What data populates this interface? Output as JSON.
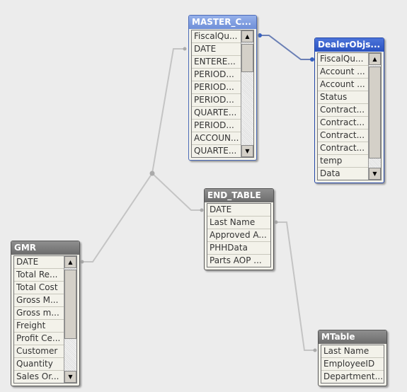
{
  "colors": {
    "link": "#c0c0c0",
    "selected_link": "#6a7fb5",
    "selected_header": "#2a52c0",
    "linked_header": "#7f9fdf",
    "table_header": "#777777"
  },
  "tables": {
    "master": {
      "title": "MASTER_C...",
      "fields": [
        "FiscalQu...",
        "DATE",
        "ENTERE...",
        "PERIOD...",
        "PERIOD...",
        "PERIOD...",
        "QUARTE...",
        "PERIOD...",
        "ACCOUN...",
        "QUARTE..."
      ]
    },
    "dealer": {
      "title": "DealerObjs...",
      "fields": [
        "FiscalQu...",
        "Account ...",
        "Account ...",
        "Status",
        "Contract...",
        "Contract...",
        "Contract...",
        "Contract...",
        "temp",
        "Data"
      ]
    },
    "end": {
      "title": "END_TABLE",
      "fields": [
        "DATE",
        "Last Name",
        "Approved A...",
        "PHHData",
        "Parts AOP ..."
      ]
    },
    "gmr": {
      "title": "GMR",
      "fields": [
        "DATE",
        "Total Re...",
        "Total Cost",
        "Gross M...",
        "Gross m...",
        "Freight",
        "Profit Ce...",
        "Customer",
        "Quantity",
        "Sales Or..."
      ]
    },
    "mtable": {
      "title": "MTable",
      "fields": [
        "Last Name",
        "EmployeeID",
        "Department..."
      ]
    }
  }
}
